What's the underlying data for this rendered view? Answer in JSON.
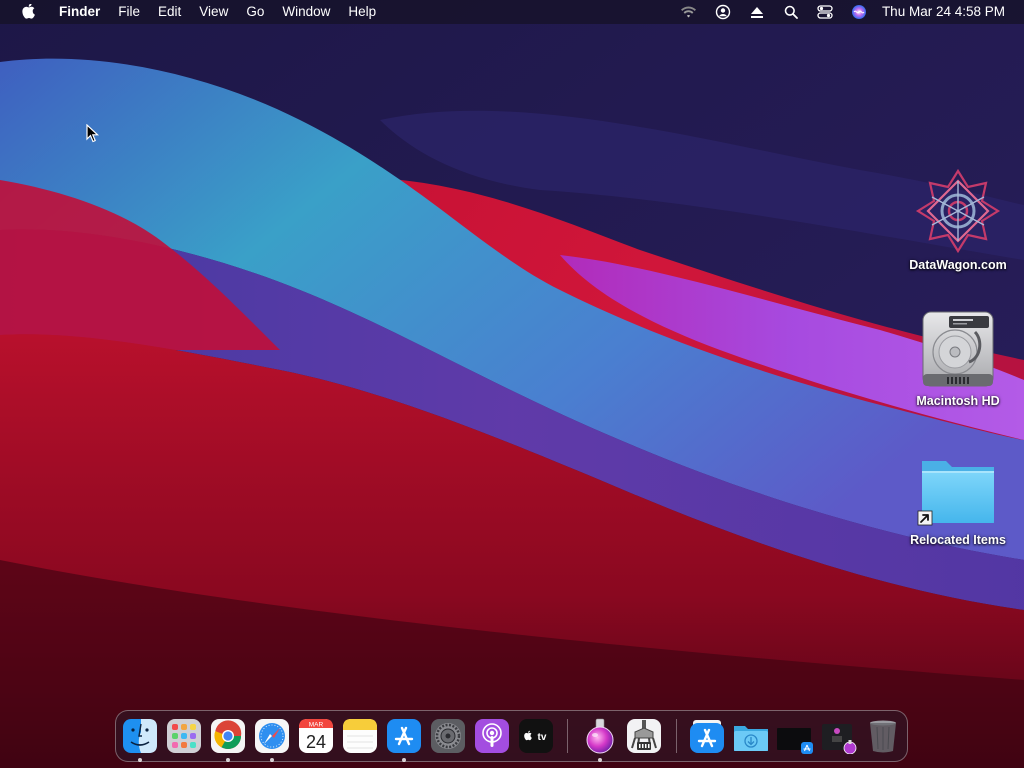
{
  "menubar": {
    "app_name": "Finder",
    "menus": [
      "File",
      "Edit",
      "View",
      "Go",
      "Window",
      "Help"
    ],
    "clock": "Thu Mar 24  4:58 PM",
    "status_icons": [
      "wifi-icon",
      "user-account-icon",
      "eject-icon",
      "spotlight-search-icon",
      "control-center-icon",
      "siri-icon"
    ]
  },
  "desktop": {
    "icons": [
      {
        "label": "DataWagon.com",
        "icon": "datawagon-logo-icon"
      },
      {
        "label": "Macintosh HD",
        "icon": "hard-drive-icon"
      },
      {
        "label": "Relocated Items",
        "icon": "folder-alias-icon"
      }
    ]
  },
  "dock": {
    "apps": [
      {
        "name": "Finder",
        "icon": "finder-icon",
        "running": true
      },
      {
        "name": "Launchpad",
        "icon": "launchpad-icon",
        "running": false
      },
      {
        "name": "Google Chrome",
        "icon": "chrome-icon",
        "running": true
      },
      {
        "name": "Safari",
        "icon": "safari-icon",
        "running": true
      },
      {
        "name": "Calendar",
        "icon": "calendar-icon",
        "running": false,
        "month": "MAR",
        "day": "24"
      },
      {
        "name": "Notes",
        "icon": "notes-icon",
        "running": false
      },
      {
        "name": "App Store",
        "icon": "app-store-icon",
        "running": true
      },
      {
        "name": "System Preferences",
        "icon": "system-preferences-icon",
        "running": false
      },
      {
        "name": "Podcasts",
        "icon": "podcasts-icon",
        "running": false
      },
      {
        "name": "TV",
        "icon": "apple-tv-icon",
        "running": false,
        "text": "tv"
      },
      {
        "name": "Installer",
        "icon": "installer-potion-icon",
        "running": true
      },
      {
        "name": "Arcade Claw",
        "icon": "claw-machine-icon",
        "running": false
      },
      {
        "name": "App Store Downloads",
        "icon": "app-store-stack-icon",
        "running": false
      },
      {
        "name": "Downloads",
        "icon": "downloads-folder-icon",
        "running": false
      },
      {
        "name": "Recent Stack",
        "icon": "recent-stack-icon",
        "running": false
      },
      {
        "name": "Applications Stack",
        "icon": "applications-stack-icon",
        "running": false
      },
      {
        "name": "Trash",
        "icon": "trash-icon",
        "running": false
      }
    ]
  },
  "colors": {
    "menubar_bg": "#16122a",
    "wallpaper_navy": "#1b1540",
    "wallpaper_red": "#c8102e",
    "wallpaper_teal": "#3a9cc4",
    "wallpaper_purple": "#a347e8",
    "folder_blue": "#5ec8f4"
  }
}
